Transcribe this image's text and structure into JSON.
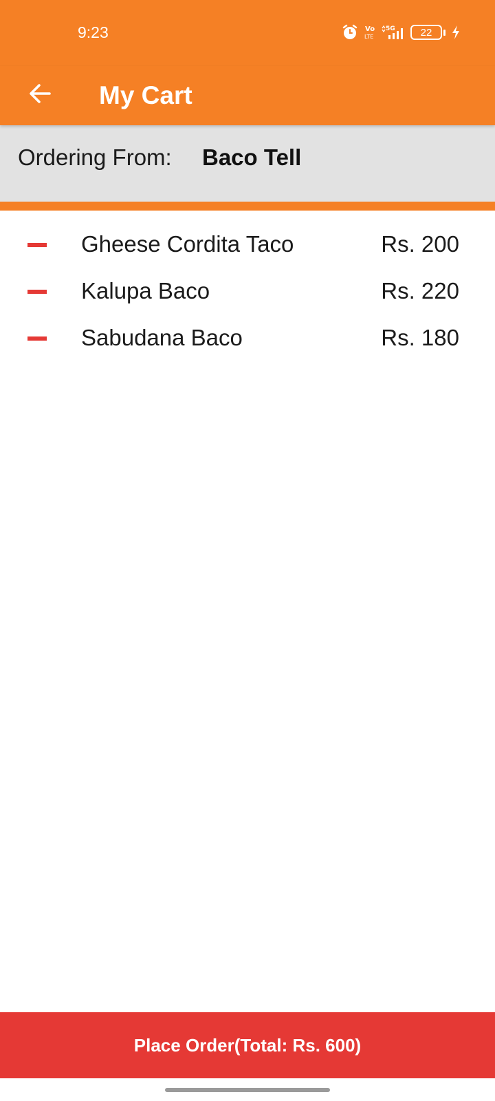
{
  "status_bar": {
    "time": "9:23",
    "battery_level": "22",
    "icons": [
      "alarm-icon",
      "volte-icon",
      "signal-5g-icon",
      "battery-icon",
      "charging-icon"
    ]
  },
  "app_bar": {
    "title": "My Cart",
    "back_icon": "arrow-back-icon"
  },
  "order_from": {
    "label": "Ordering From:",
    "restaurant": "Baco Tell"
  },
  "cart": {
    "items": [
      {
        "name": "Gheese Cordita Taco",
        "price": "Rs. 200"
      },
      {
        "name": "Kalupa Baco",
        "price": "Rs. 220"
      },
      {
        "name": "Sabudana Baco",
        "price": "Rs. 180"
      }
    ]
  },
  "footer": {
    "place_order_label": "Place Order(Total: Rs. 600)"
  },
  "colors": {
    "primary": "#F58025",
    "accent": "#E53935",
    "header_bg": "#E2E2E2"
  }
}
